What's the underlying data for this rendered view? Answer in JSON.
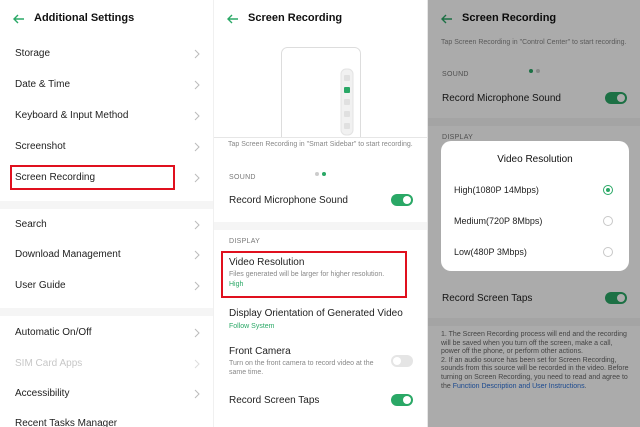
{
  "colors": {
    "accent": "#2aa866",
    "highlight": "#e0101e"
  },
  "panel1": {
    "title": "Additional Settings",
    "items": [
      {
        "label": "Storage"
      },
      {
        "label": "Date & Time"
      },
      {
        "label": "Keyboard & Input Method"
      },
      {
        "label": "Screenshot"
      },
      {
        "label": "Screen Recording"
      },
      {
        "label": "Search"
      },
      {
        "label": "Download Management"
      },
      {
        "label": "User Guide"
      },
      {
        "label": "Automatic On/Off"
      },
      {
        "label": "SIM Card Apps"
      },
      {
        "label": "Accessibility"
      },
      {
        "label": "Recent Tasks Manager"
      }
    ]
  },
  "panel2": {
    "title": "Screen Recording",
    "tip": "Tap Screen Recording in \"Smart Sidebar\" to start recording.",
    "sound_header": "SOUND",
    "mic_label": "Record Microphone Sound",
    "mic_on": true,
    "display_header": "DISPLAY",
    "video_res_label": "Video Resolution",
    "video_res_desc": "Files generated will be larger for higher resolution.",
    "video_res_value": "High",
    "orientation_label": "Display Orientation of Generated Video",
    "orientation_value": "Follow System",
    "front_cam_label": "Front Camera",
    "front_cam_desc": "Turn on the front camera to record video at the same time.",
    "front_cam_on": false,
    "taps_label": "Record Screen Taps",
    "taps_on": true
  },
  "panel3": {
    "title": "Screen Recording",
    "tip": "Tap Screen Recording in \"Control Center\" to start recording.",
    "sound_header": "SOUND",
    "mic_label": "Record Microphone Sound",
    "display_header_partial": "DISPLAY",
    "taps_label": "Record Screen Taps",
    "dialog": {
      "title": "Video Resolution",
      "options": [
        {
          "label": "High(1080P 14Mbps)",
          "selected": true
        },
        {
          "label": "Medium(720P 8Mbps)",
          "selected": false
        },
        {
          "label": "Low(480P 3Mbps)",
          "selected": false
        }
      ]
    },
    "note_1": "1. The Screen Recording process will end and the recording will be saved when you turn off the screen, make a call, power off the phone, or perform other actions.",
    "note_2_prefix": "2. If an audio source has been set for Screen Recording, sounds from this source will be recorded in the video. Before turning on Screen Recording, you need to read and agree to the ",
    "note_link": "Function Description and User Instructions",
    "note_end": "."
  }
}
